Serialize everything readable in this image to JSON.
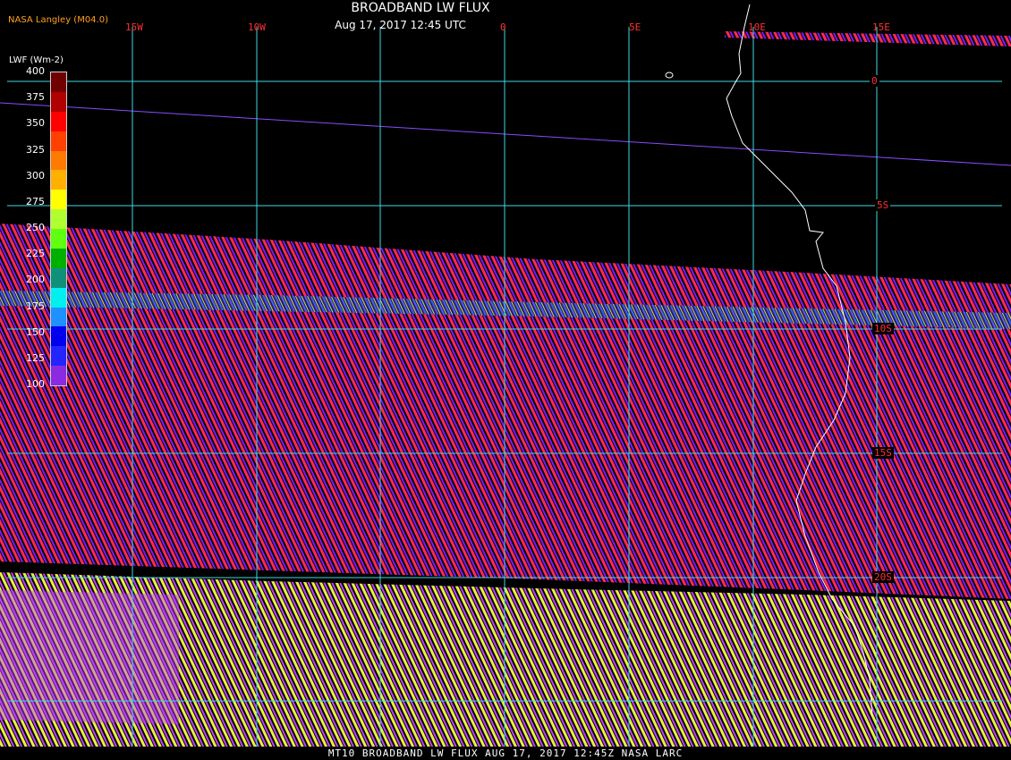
{
  "header": {
    "title": "BROADBAND LW FLUX",
    "timestamp": "Aug 17, 2017 12:45 UTC",
    "source": "NASA Langley (M04.0)"
  },
  "footer": {
    "text": "MT10  BROADBAND LW FLUX   AUG 17, 2017 12:45Z   NASA LARC"
  },
  "colorbar": {
    "title": "LWF (Wm-2)",
    "ticks": [
      "100",
      "125",
      "150",
      "175",
      "200",
      "225",
      "250",
      "275",
      "300",
      "325",
      "350",
      "375",
      "400"
    ],
    "colors": [
      "#8a2be2",
      "#2424ff",
      "#0000ee",
      "#1e90ff",
      "#00f0f0",
      "#10907a",
      "#00b000",
      "#60ff10",
      "#b0ff30",
      "#ffff00",
      "#ffb000",
      "#ff7a00",
      "#ff4000",
      "#ff0000",
      "#b00000",
      "#700000"
    ]
  },
  "grid": {
    "lon_labels": [
      "15W",
      "10W",
      "0",
      "5E",
      "10E",
      "15E"
    ],
    "lat_labels": [
      "0",
      "5S",
      "10S",
      "15S",
      "20S"
    ],
    "line_color": "#40d8e0"
  },
  "palette": {
    "swath_a": "#ff2a50",
    "swath_b": "#7a1aff",
    "swath_c": "#e8f040",
    "swath_d": "#c040ff",
    "orbit_line": "#8a4aff",
    "coastline": "#ffffff"
  }
}
